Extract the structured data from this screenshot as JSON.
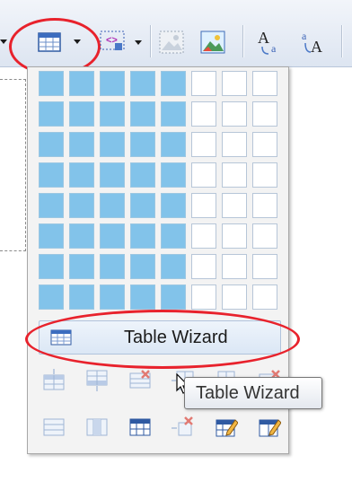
{
  "table_grid": {
    "rows": 8,
    "cols": 8,
    "selected_rows": 8,
    "selected_cols": 5
  },
  "wizard": {
    "label": "Table Wizard"
  },
  "tooltip": {
    "text": "Table Wizard"
  },
  "colors": {
    "cell_selected": "#82c3ea",
    "highlight_circle": "#e8222c"
  },
  "icons": {
    "toolbar": [
      "table-icon",
      "anchor-frame-icon",
      "image-icon",
      "picture-icon",
      "character-style-icon",
      "change-case-icon"
    ],
    "row1": [
      "insert-row-above-icon",
      "insert-row-below-icon",
      "delete-row-icon",
      "delete-column-icon"
    ],
    "row2": [
      "split-cell-icon",
      "merge-column-icon",
      "table-header-icon",
      "delete-cell-icon",
      "edit-table-icon",
      "edit-cell-icon"
    ]
  }
}
